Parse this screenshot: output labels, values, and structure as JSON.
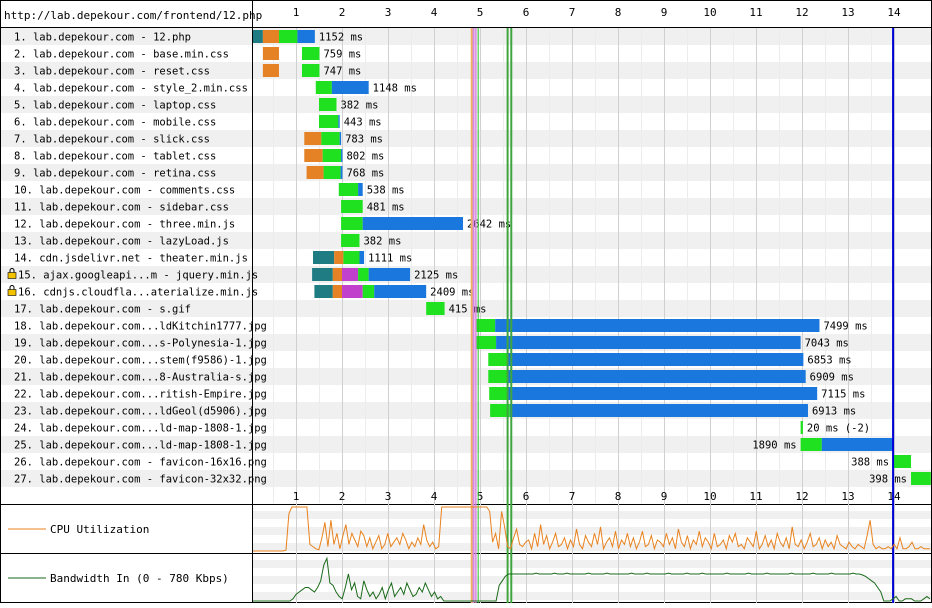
{
  "page_url": "http://lab.depekour.com/frontend/12.php",
  "tick_labels": [
    "1",
    "2",
    "3",
    "4",
    "5",
    "6",
    "7",
    "8",
    "9",
    "10",
    "11",
    "12",
    "13",
    "14"
  ],
  "colors": {
    "dns": "#1f7c83",
    "connect": "#e58226",
    "ssl": "#c141cd",
    "ttfb": "#1fe11f",
    "download": "#1977dd",
    "cpu_line": "#e8821f",
    "bandwidth_line": "#1a6a1a",
    "start_render": "#28c228",
    "dom_content_loaded": "#d888df",
    "dom_element": "#f0b060",
    "onload": "#3fa63f",
    "document_complete": "#0000d8"
  },
  "chart_data": {
    "type": "waterfall",
    "xlabel": "",
    "xlim": [
      0,
      14.2
    ],
    "grid": true,
    "markers": {
      "dom_element": 4.82,
      "dom_content_loaded_start": 4.86,
      "dom_content_loaded_end": 4.91,
      "start_render": 4.96,
      "onload_start": 5.6,
      "onload_end": 5.68,
      "document_complete": 13.98
    },
    "requests": [
      {
        "label": "1. lab.depekour.com - 12.php",
        "duration": "1152 ms",
        "secure": false,
        "phases": [
          [
            "dns",
            0,
            0.28
          ],
          [
            "connect",
            0.28,
            0.63
          ],
          [
            "ttfb",
            0.63,
            1.03
          ],
          [
            "download",
            1.03,
            1.41
          ]
        ]
      },
      {
        "label": "2. lab.depekour.com - base.min.css",
        "duration": "759 ms",
        "secure": false,
        "phases": [
          [
            "connect",
            0.28,
            0.63
          ],
          [
            "ttfb",
            1.13,
            1.51
          ]
        ]
      },
      {
        "label": "3. lab.depekour.com - reset.css",
        "duration": "747 ms",
        "secure": false,
        "phases": [
          [
            "connect",
            0.28,
            0.63
          ],
          [
            "ttfb",
            1.13,
            1.51
          ]
        ]
      },
      {
        "label": "4. lab.depekour.com - style_2.min.css",
        "duration": "1148 ms",
        "secure": false,
        "phases": [
          [
            "ttfb",
            1.43,
            1.78
          ],
          [
            "download",
            1.78,
            2.58
          ]
        ]
      },
      {
        "label": "5. lab.depekour.com - laptop.css",
        "duration": "382 ms",
        "secure": false,
        "phases": [
          [
            "ttfb",
            1.5,
            1.88
          ]
        ]
      },
      {
        "label": "6. lab.depekour.com - mobile.css",
        "duration": "443 ms",
        "secure": false,
        "phases": [
          [
            "ttfb",
            1.5,
            1.92
          ],
          [
            "download",
            1.92,
            1.95
          ]
        ]
      },
      {
        "label": "7. lab.depekour.com - slick.css",
        "duration": "783 ms",
        "secure": false,
        "phases": [
          [
            "connect",
            1.18,
            1.55
          ],
          [
            "ttfb",
            1.55,
            1.95
          ],
          [
            "download",
            1.95,
            1.98
          ]
        ]
      },
      {
        "label": "8. lab.depekour.com - tablet.css",
        "duration": "802 ms",
        "secure": false,
        "phases": [
          [
            "connect",
            1.18,
            1.58
          ],
          [
            "ttfb",
            1.58,
            1.98
          ],
          [
            "download",
            1.98,
            2.01
          ]
        ]
      },
      {
        "label": "9. lab.depekour.com - retina.css",
        "duration": "768 ms",
        "secure": false,
        "phases": [
          [
            "connect",
            1.23,
            1.6
          ],
          [
            "ttfb",
            1.6,
            1.97
          ],
          [
            "download",
            1.97,
            2.01
          ]
        ]
      },
      {
        "label": "10. lab.depekour.com - comments.css",
        "duration": "538 ms",
        "secure": false,
        "phases": [
          [
            "ttfb",
            1.93,
            2.35
          ],
          [
            "download",
            2.35,
            2.45
          ]
        ]
      },
      {
        "label": "11. lab.depekour.com - sidebar.css",
        "duration": "481 ms",
        "secure": false,
        "phases": [
          [
            "ttfb",
            1.98,
            2.45
          ]
        ]
      },
      {
        "label": "12. lab.depekour.com - three.min.js",
        "duration": "2642 ms",
        "secure": false,
        "phases": [
          [
            "ttfb",
            1.98,
            2.45
          ],
          [
            "download",
            2.45,
            4.63
          ]
        ]
      },
      {
        "label": "13. lab.depekour.com - lazyLoad.js",
        "duration": "382 ms",
        "secure": false,
        "phases": [
          [
            "ttfb",
            1.98,
            2.38
          ]
        ]
      },
      {
        "label": "14. cdn.jsdelivr.net - theater.min.js",
        "duration": "1111 ms",
        "secure": false,
        "phases": [
          [
            "dns",
            1.37,
            1.83
          ],
          [
            "connect",
            1.83,
            2.03
          ],
          [
            "ttfb",
            2.03,
            2.38
          ],
          [
            "download",
            2.38,
            2.48
          ]
        ]
      },
      {
        "label": "15. ajax.googleapi...m - jquery.min.js",
        "duration": "2125 ms",
        "secure": true,
        "phases": [
          [
            "dns",
            1.35,
            1.8
          ],
          [
            "connect",
            1.8,
            2.0
          ],
          [
            "ssl",
            2.0,
            2.35
          ],
          [
            "ttfb",
            2.35,
            2.58
          ],
          [
            "download",
            2.58,
            3.48
          ]
        ]
      },
      {
        "label": "16. cdnjs.cloudfla...aterialize.min.js",
        "duration": "2409 ms",
        "secure": true,
        "phases": [
          [
            "dns",
            1.4,
            1.8
          ],
          [
            "connect",
            1.8,
            2.0
          ],
          [
            "ssl",
            2.0,
            2.45
          ],
          [
            "ttfb",
            2.45,
            2.7
          ],
          [
            "download",
            2.7,
            3.83
          ]
        ]
      },
      {
        "label": "17. lab.depekour.com - s.gif",
        "duration": "415 ms",
        "secure": false,
        "phases": [
          [
            "ttfb",
            3.83,
            4.23
          ]
        ]
      },
      {
        "label": "18. lab.depekour.com...ldKitchin1777.jpg",
        "duration": "7499 ms",
        "secure": false,
        "phases": [
          [
            "ttfb",
            4.92,
            5.33
          ],
          [
            "download",
            5.33,
            12.38
          ]
        ]
      },
      {
        "label": "19. lab.depekour.com...s-Polynesia-1.jpg",
        "duration": "7043 ms",
        "secure": false,
        "phases": [
          [
            "ttfb",
            4.92,
            5.35
          ],
          [
            "download",
            5.35,
            11.97
          ]
        ]
      },
      {
        "label": "20. lab.depekour.com...stem(f9586)-1.jpg",
        "duration": "6853 ms",
        "secure": false,
        "phases": [
          [
            "ttfb",
            5.18,
            5.6
          ],
          [
            "download",
            5.6,
            12.03
          ]
        ]
      },
      {
        "label": "21. lab.depekour.com...8-Australia-s.jpg",
        "duration": "6909 ms",
        "secure": false,
        "phases": [
          [
            "ttfb",
            5.18,
            5.6
          ],
          [
            "download",
            5.6,
            12.08
          ]
        ]
      },
      {
        "label": "22. lab.depekour.com...ritish-Empire.jpg",
        "duration": "7115 ms",
        "secure": false,
        "phases": [
          [
            "ttfb",
            5.2,
            5.62
          ],
          [
            "download",
            5.62,
            12.33
          ]
        ]
      },
      {
        "label": "23. lab.depekour.com...ldGeol(d5906).jpg",
        "duration": "6913 ms",
        "secure": false,
        "phases": [
          [
            "ttfb",
            5.22,
            5.65
          ],
          [
            "download",
            5.65,
            12.13
          ]
        ]
      },
      {
        "label": "24. lab.depekour.com...ld-map-1808-1.jpg",
        "duration": "20 ms (-2)",
        "secure": false,
        "phases": [
          [
            "ttfb",
            11.97,
            12.02
          ]
        ]
      },
      {
        "label": "25. lab.depekour.com...ld-map-1808-1.jpg",
        "duration": "1890 ms",
        "secure": false,
        "phases": [
          [
            "ttfb",
            11.97,
            12.43
          ],
          [
            "download",
            12.43,
            13.98
          ]
        ]
      },
      {
        "label": "26. lab.depekour.com - favicon-16x16.png",
        "duration": "388 ms",
        "secure": false,
        "phases": [
          [
            "ttfb",
            13.98,
            14.37
          ]
        ]
      },
      {
        "label": "27. lab.depekour.com - favicon-32x32.png",
        "duration": "398 ms",
        "secure": false,
        "phases": [
          [
            "ttfb",
            14.37,
            14.8
          ]
        ]
      }
    ],
    "cpu": {
      "label": "CPU Utilization",
      "values_percent": [
        0,
        0,
        0,
        0,
        0,
        0,
        0,
        0,
        0,
        0,
        0,
        2,
        85,
        100,
        100,
        100,
        100,
        100,
        100,
        15,
        10,
        5,
        3,
        30,
        65,
        10,
        70,
        15,
        40,
        5,
        35,
        60,
        15,
        40,
        25,
        10,
        45,
        35,
        10,
        30,
        5,
        20,
        35,
        5,
        15,
        40,
        10,
        20,
        30,
        15,
        40,
        25,
        5,
        20,
        10,
        30,
        15,
        60,
        25,
        10,
        20,
        5,
        10,
        100,
        100,
        100,
        100,
        100,
        100,
        100,
        100,
        100,
        100,
        100,
        100,
        100,
        100,
        100,
        100,
        90,
        20,
        40,
        5,
        90,
        55,
        10,
        5,
        30,
        50,
        15,
        10,
        20,
        25,
        5,
        40,
        10,
        60,
        15,
        35,
        5,
        20,
        40,
        10,
        15,
        30,
        5,
        25,
        10,
        50,
        15,
        5,
        35,
        20,
        10,
        40,
        15,
        55,
        5,
        20,
        30,
        10,
        45,
        5,
        25,
        15,
        40,
        10,
        30,
        5,
        20,
        45,
        10,
        15,
        35,
        5,
        25,
        20,
        10,
        40,
        15,
        30,
        5,
        50,
        20,
        10,
        35,
        5,
        25,
        15,
        45,
        10,
        30,
        20,
        5,
        40,
        10,
        15,
        25,
        5,
        35,
        20,
        40,
        10,
        15,
        5,
        30,
        20,
        10,
        45,
        5,
        15,
        35,
        10,
        25,
        5,
        40,
        20,
        10,
        30,
        5,
        55,
        15,
        10,
        25,
        5,
        20,
        40,
        10,
        15,
        30,
        5,
        25,
        10,
        20,
        5,
        35,
        15,
        10,
        5,
        20,
        10,
        5,
        15,
        10,
        5,
        35,
        70,
        15,
        5,
        10,
        5,
        5,
        10,
        5,
        15,
        5,
        30,
        5,
        5,
        10,
        20,
        5,
        5,
        10,
        5,
        5,
        5
      ]
    },
    "bandwidth": {
      "label": "Bandwidth In (0 - 780 Kbps)",
      "values_percent": [
        0,
        0,
        0,
        0,
        0,
        0,
        0,
        0,
        0,
        0,
        0,
        0,
        0,
        5,
        15,
        20,
        25,
        30,
        30,
        25,
        20,
        30,
        45,
        80,
        95,
        40,
        35,
        20,
        10,
        5,
        30,
        60,
        25,
        40,
        10,
        5,
        45,
        25,
        10,
        20,
        5,
        15,
        30,
        5,
        25,
        40,
        10,
        20,
        30,
        15,
        40,
        25,
        10,
        15,
        30,
        20,
        40,
        25,
        10,
        20,
        5,
        10,
        0,
        0,
        0,
        0,
        0,
        0,
        0,
        0,
        0,
        0,
        0,
        0,
        0,
        0,
        0,
        0,
        0,
        0,
        35,
        45,
        55,
        60,
        60,
        60,
        60,
        60,
        60,
        60,
        60,
        60,
        62,
        60,
        60,
        60,
        60,
        60,
        62,
        60,
        60,
        60,
        62,
        60,
        60,
        60,
        60,
        60,
        60,
        62,
        60,
        60,
        60,
        60,
        60,
        62,
        60,
        60,
        60,
        60,
        60,
        60,
        60,
        62,
        60,
        60,
        60,
        60,
        62,
        60,
        60,
        60,
        60,
        60,
        60,
        62,
        60,
        60,
        60,
        60,
        60,
        62,
        60,
        60,
        60,
        60,
        62,
        60,
        60,
        60,
        60,
        60,
        60,
        60,
        62,
        60,
        60,
        60,
        60,
        60,
        60,
        62,
        60,
        60,
        60,
        60,
        60,
        62,
        60,
        60,
        60,
        60,
        60,
        60,
        60,
        62,
        60,
        60,
        60,
        60,
        60,
        60,
        62,
        60,
        60,
        60,
        60,
        60,
        62,
        60,
        60,
        60,
        60,
        60,
        60,
        62,
        60,
        60,
        58,
        55,
        50,
        45,
        40,
        30,
        20,
        0,
        0,
        0,
        5,
        10,
        0,
        0,
        5,
        5,
        5,
        0,
        0,
        0,
        5,
        10,
        5
      ]
    }
  }
}
